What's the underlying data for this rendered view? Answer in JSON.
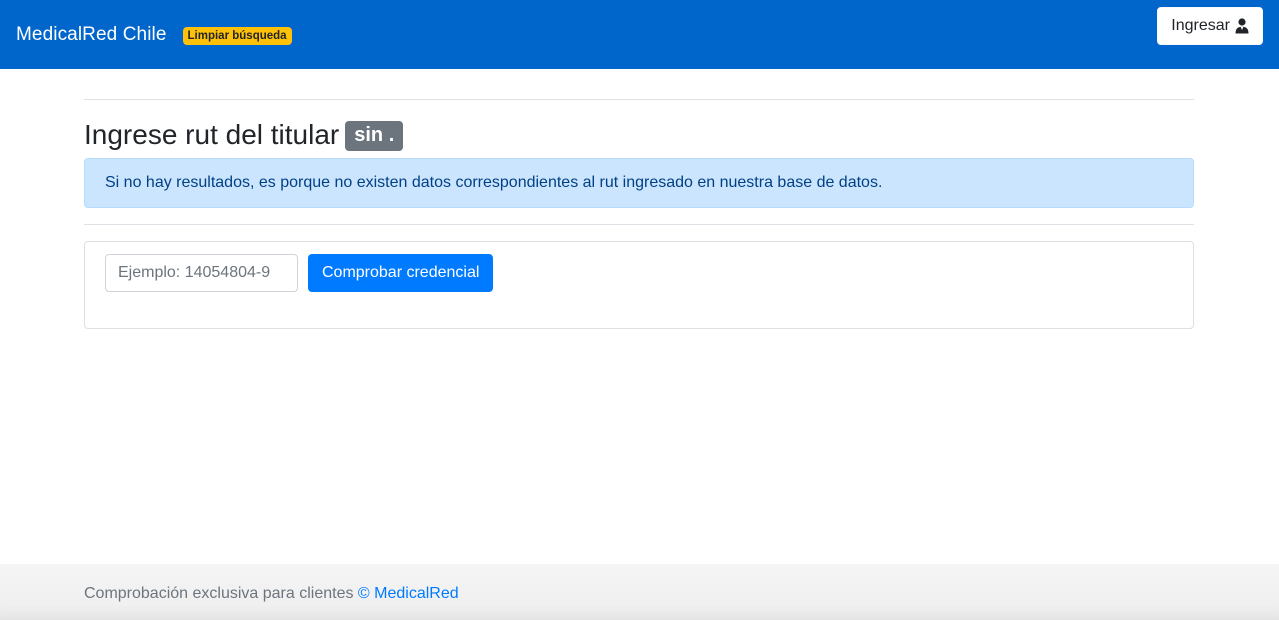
{
  "navbar": {
    "brand": "MedicalRed Chile",
    "clear_badge": "Limpiar búsqueda",
    "login_label": "Ingresar",
    "login_icon": "user-icon"
  },
  "main": {
    "heading": "Ingrese rut del titular",
    "rut_badge": "sin .",
    "alert_text": "Si no hay resultados, es porque no existen datos correspondientes al rut ingresado en nuestra base de datos.",
    "rut_input": {
      "value": "",
      "placeholder": "Ejemplo: 14054804-9"
    },
    "check_button": "Comprobar credencial"
  },
  "footer": {
    "text": "Comprobación exclusiva para clientes",
    "link": "© MedicalRed"
  },
  "colors": {
    "navbar": "#0066cc",
    "badge_warning": "#ffc107",
    "badge_secondary": "#6c757d",
    "alert_bg": "#cce5ff",
    "alert_text": "#004085",
    "primary": "#007bff"
  }
}
